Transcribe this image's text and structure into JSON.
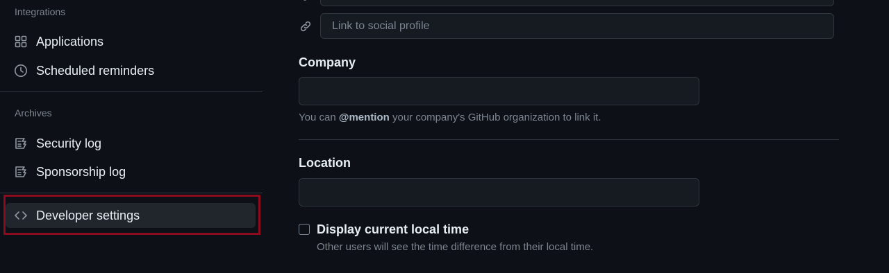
{
  "sidebar": {
    "integrations_heading": "Integrations",
    "integrations_items": [
      {
        "label": "Applications",
        "icon": "apps-grid-icon"
      },
      {
        "label": "Scheduled reminders",
        "icon": "clock-icon"
      }
    ],
    "archives_heading": "Archives",
    "archives_items": [
      {
        "label": "Security log",
        "icon": "log-icon"
      },
      {
        "label": "Sponsorship log",
        "icon": "log-icon"
      }
    ],
    "developer_settings": {
      "label": "Developer settings",
      "icon": "code-icon"
    }
  },
  "main": {
    "social_link_placeholder": "Link to social profile",
    "company": {
      "label": "Company",
      "value": "",
      "note_prefix": "You can ",
      "note_mention": "@mention",
      "note_suffix": " your company's GitHub organization to link it."
    },
    "location": {
      "label": "Location",
      "value": ""
    },
    "local_time": {
      "label": "Display current local time",
      "note": "Other users will see the time difference from their local time.",
      "checked": false
    }
  },
  "colors": {
    "background": "#0d1117",
    "highlight_border": "#8b0d1d",
    "input_bg": "#161b22",
    "border": "#30363d"
  }
}
